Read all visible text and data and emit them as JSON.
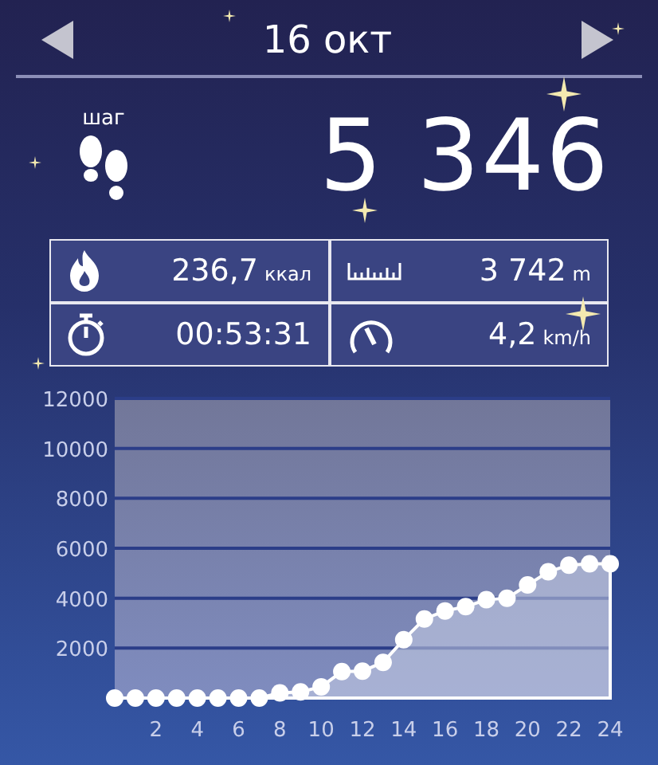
{
  "header": {
    "date": "16 окт"
  },
  "steps": {
    "label": "шаг",
    "count": "5 346"
  },
  "stats": [
    {
      "kind": "calories",
      "value": "236,7",
      "unit": "ккал"
    },
    {
      "kind": "distance",
      "value": "3 742",
      "unit": "m"
    },
    {
      "kind": "duration",
      "value": "00:53:31"
    },
    {
      "kind": "speed",
      "value": "4,2",
      "unit": "km/h"
    }
  ],
  "chart": {
    "chart_data": {
      "type": "area",
      "x": [
        0,
        1,
        2,
        3,
        4,
        5,
        6,
        7,
        8,
        9,
        10,
        11,
        12,
        13,
        14,
        15,
        16,
        17,
        18,
        19,
        20,
        21,
        22,
        23,
        24
      ],
      "grid": true,
      "series": [
        {
          "color": "#ffffff",
          "values": [
            0,
            0,
            0,
            0,
            0,
            0,
            0,
            0,
            210,
            250,
            450,
            1060,
            1080,
            1430,
            2340,
            3170,
            3490,
            3660,
            3940,
            4000,
            4530,
            5060,
            5320,
            5380,
            5380
          ]
        }
      ],
      "xlim": [
        0,
        24
      ],
      "ylim": [
        0,
        12000
      ],
      "xticks": [
        2,
        4,
        6,
        8,
        10,
        12,
        14,
        16,
        18,
        20,
        22,
        24
      ],
      "yticks": [
        2000,
        4000,
        6000,
        8000,
        10000,
        12000
      ]
    }
  }
}
